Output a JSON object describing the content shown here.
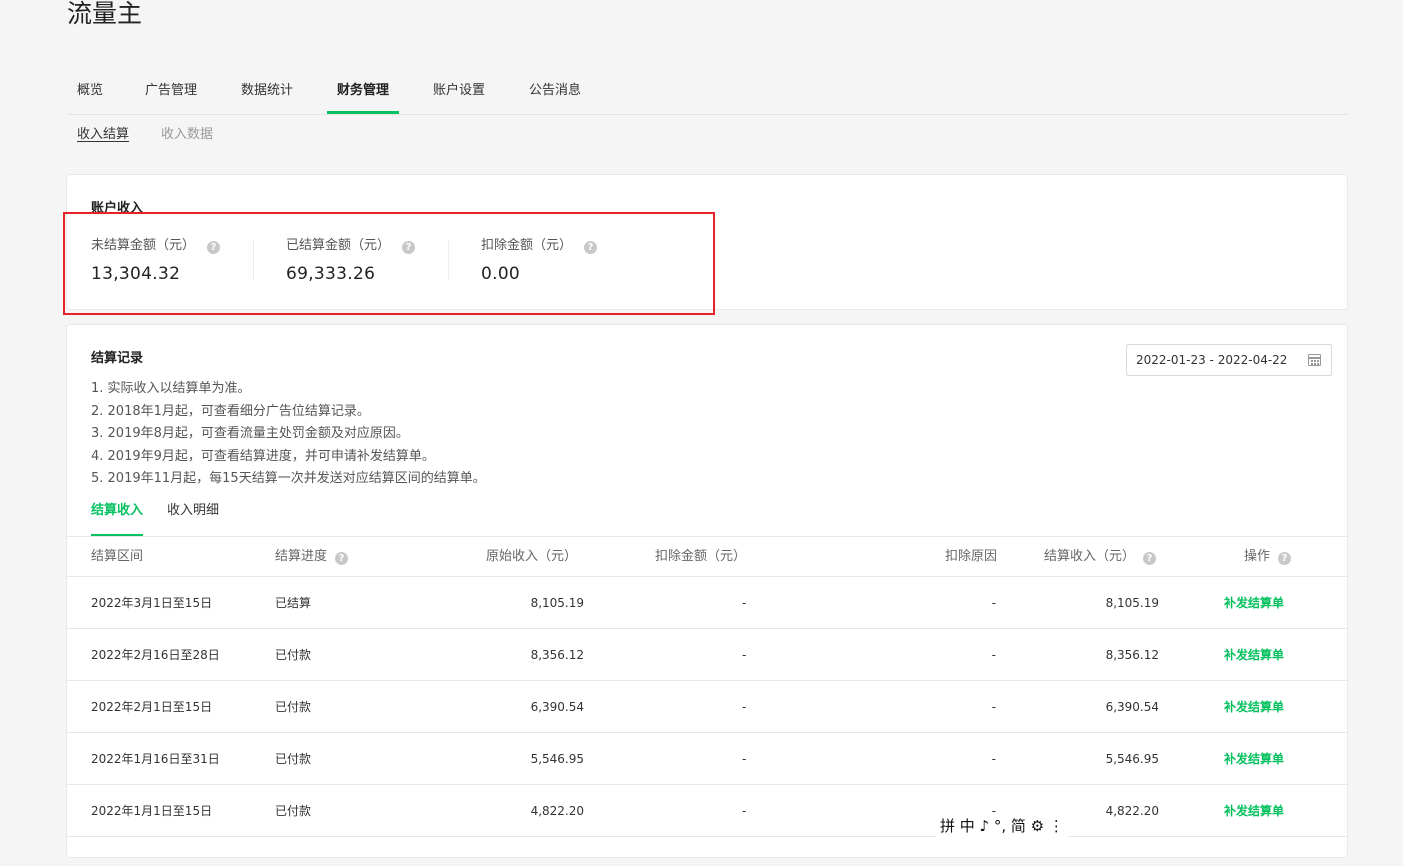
{
  "app": {
    "title": "流量主"
  },
  "main_tabs": [
    {
      "label": "概览"
    },
    {
      "label": "广告管理"
    },
    {
      "label": "数据统计"
    },
    {
      "label": "财务管理",
      "active": true
    },
    {
      "label": "账户设置"
    },
    {
      "label": "公告消息"
    }
  ],
  "sub_tabs": [
    {
      "label": "收入结算",
      "active": true
    },
    {
      "label": "收入数据"
    }
  ],
  "income": {
    "title": "账户收入",
    "stats": [
      {
        "label": "未结算金额（元）",
        "value": "13,304.32"
      },
      {
        "label": "已结算金额（元）",
        "value": "69,333.26"
      },
      {
        "label": "扣除金额（元）",
        "value": "0.00"
      }
    ]
  },
  "records": {
    "title": "结算记录",
    "notes": [
      "1. 实际收入以结算单为准。",
      "2. 2018年1月起，可查看细分广告位结算记录。",
      "3. 2019年8月起，可查看流量主处罚金额及对应原因。",
      "4. 2019年9月起，可查看结算进度，并可申请补发结算单。",
      "5. 2019年11月起，每15天结算一次并发送对应结算区间的结算单。"
    ],
    "date_range": "2022-01-23 - 2022-04-22",
    "tabs": [
      {
        "label": "结算收入",
        "active": true
      },
      {
        "label": "收入明细"
      }
    ],
    "columns": {
      "period": "结算区间",
      "progress": "结算进度",
      "original": "原始收入（元）",
      "deduction": "扣除金额（元）",
      "reason": "扣除原因",
      "settled": "结算收入（元）",
      "action": "操作"
    },
    "rows": [
      {
        "period": "2022年3月1日至15日",
        "progress": "已结算",
        "original": "8,105.19",
        "deduction": "-",
        "reason": "-",
        "settled": "8,105.19",
        "action": "补发结算单"
      },
      {
        "period": "2022年2月16日至28日",
        "progress": "已付款",
        "original": "8,356.12",
        "deduction": "-",
        "reason": "-",
        "settled": "8,356.12",
        "action": "补发结算单"
      },
      {
        "period": "2022年2月1日至15日",
        "progress": "已付款",
        "original": "6,390.54",
        "deduction": "-",
        "reason": "-",
        "settled": "6,390.54",
        "action": "补发结算单"
      },
      {
        "period": "2022年1月16日至31日",
        "progress": "已付款",
        "original": "5,546.95",
        "deduction": "-",
        "reason": "-",
        "settled": "5,546.95",
        "action": "补发结算单"
      },
      {
        "period": "2022年1月1日至15日",
        "progress": "已付款",
        "original": "4,822.20",
        "deduction": "-",
        "reason": "-",
        "settled": "4,822.20",
        "action": "补发结算单"
      }
    ]
  },
  "ime_toolbar": {
    "text": "拼 中 ♪ °, 简 ⚙ ⋮"
  },
  "colors": {
    "accent": "#07c160",
    "highlight": "#e6212a"
  }
}
